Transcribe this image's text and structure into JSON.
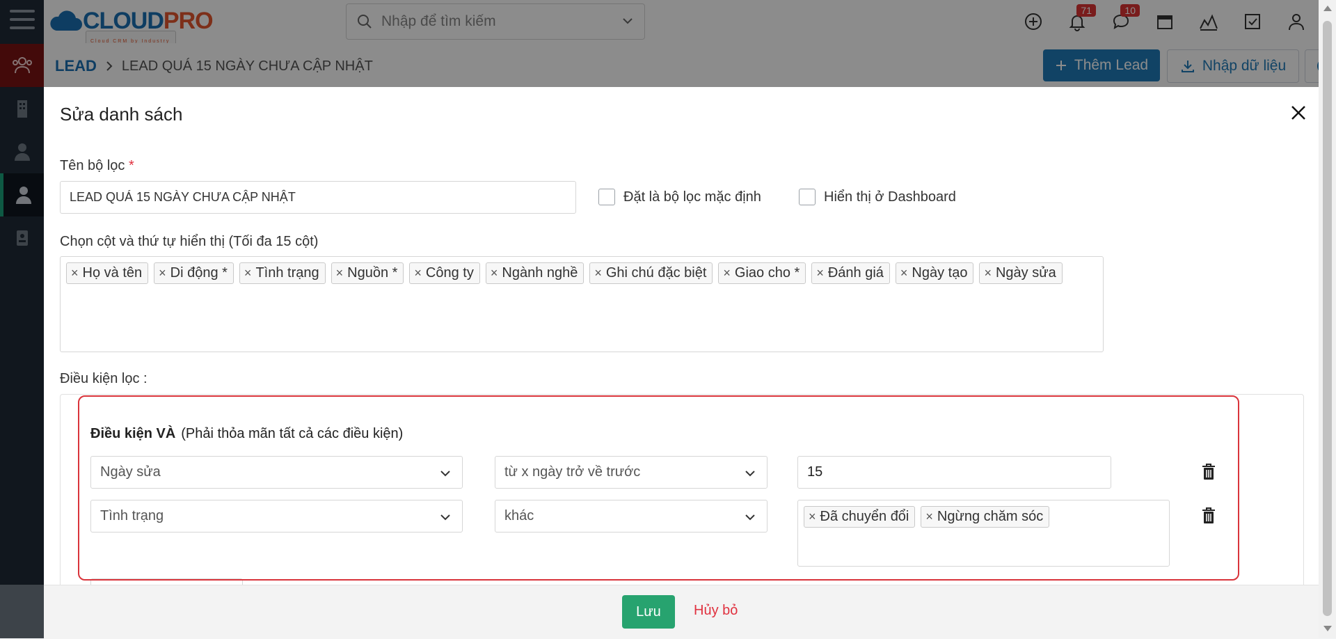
{
  "app": {
    "logo_text_a": "CLOUD",
    "logo_text_b": "PRO",
    "logo_tagline": "Cloud CRM by Industry",
    "search_placeholder": "Nhập để tìm kiếm",
    "notifications_count": "71",
    "messages_count": "10"
  },
  "breadcrumb": {
    "root": "LEAD",
    "current": "LEAD QUÁ 15 NGÀY CHƯA CẬP NHẬT"
  },
  "toolbar": {
    "add_label": "Thêm Lead",
    "import_label": "Nhập dữ liệu"
  },
  "modal": {
    "title": "Sửa danh sách",
    "filter_name_label": "Tên bộ lọc",
    "required_mark": "*",
    "filter_name_value": "LEAD QUÁ 15 NGÀY CHƯA CẬP NHẬT",
    "default_filter_label": "Đặt là bộ lọc mặc định",
    "show_dashboard_label": "Hiển thị ở Dashboard",
    "columns_label": "Chọn cột và thứ tự hiển thị (Tối đa 15 cột)",
    "columns": [
      "Họ và tên",
      "Di động *",
      "Tình trạng",
      "Nguồn *",
      "Công ty",
      "Ngành nghề",
      "Ghi chú đặc biệt",
      "Giao cho *",
      "Đánh giá",
      "Ngày tạo",
      "Ngày sửa"
    ],
    "conditions_label": "Điều kiện lọc :",
    "and_title": "Điều kiện VÀ",
    "and_desc": "(Phải thỏa mãn tất cả các điều kiện)",
    "conditions": [
      {
        "field": "Ngày sửa",
        "operator": "từ x ngày trở về trước",
        "value": "15"
      },
      {
        "field": "Tình trạng",
        "operator": "khác",
        "values": [
          "Đã chuyển đổi",
          "Ngừng chăm sóc"
        ]
      }
    ],
    "save_label": "Lưu",
    "cancel_label": "Hủy bỏ"
  },
  "colors": {
    "primary": "#1f7ab8",
    "success": "#27a36f",
    "danger": "#e0313f",
    "sidebar": "#1f2b37"
  }
}
